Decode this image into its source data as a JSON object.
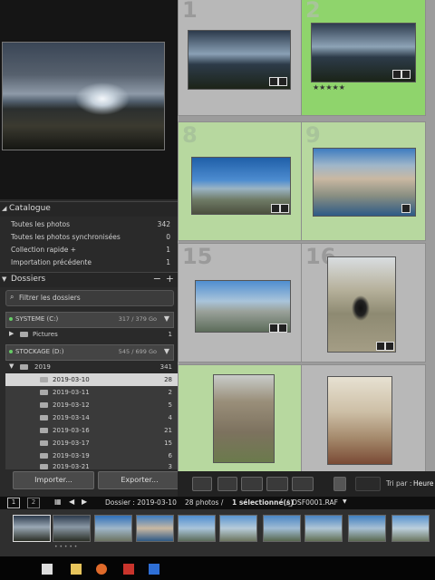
{
  "catalog": {
    "title": "Catalogue",
    "rows": [
      {
        "label": "Toutes les photos",
        "count": "342"
      },
      {
        "label": "Toutes les photos synchronisées",
        "count": "0"
      },
      {
        "label": "Collection rapide +",
        "count": "1"
      },
      {
        "label": "Importation précédente",
        "count": "1"
      }
    ]
  },
  "folders": {
    "title": "Dossiers",
    "filter_placeholder": "Filtrer les dossiers",
    "volumes": [
      {
        "name": "SYSTEME (C:)",
        "size": "317 / 379 Go"
      },
      {
        "name": "STOCKAGE (D:)",
        "size": "545 / 699 Go"
      }
    ],
    "pictures": {
      "name": "Pictures",
      "count": "1"
    },
    "year": {
      "name": "2019",
      "count": "341"
    },
    "items": [
      {
        "name": "2019-03-10",
        "count": "28"
      },
      {
        "name": "2019-03-11",
        "count": "2"
      },
      {
        "name": "2019-03-12",
        "count": "5"
      },
      {
        "name": "2019-03-14",
        "count": "4"
      },
      {
        "name": "2019-03-16",
        "count": "21"
      },
      {
        "name": "2019-03-17",
        "count": "15"
      },
      {
        "name": "2019-03-19",
        "count": "6"
      },
      {
        "name": "2019-03-21",
        "count": "3"
      }
    ]
  },
  "buttons": {
    "import": "Importer...",
    "export": "Exporter..."
  },
  "grid": {
    "cell_numbers": [
      "1",
      "2",
      "8",
      "9",
      "15",
      "16"
    ],
    "stars": "★★★★★",
    "sort_label": "Tri par :",
    "sort_value": "Heure"
  },
  "status": {
    "page1": "1",
    "page2": "2",
    "folder": "Dossier : 2019-03-10",
    "count": "28 photos /",
    "selected": "1 sélectionné(s)",
    "file": "/_DSF0001.RAF"
  },
  "colors": {
    "accent_selected": "#8fd46c",
    "panel": "#2a2a2a"
  }
}
